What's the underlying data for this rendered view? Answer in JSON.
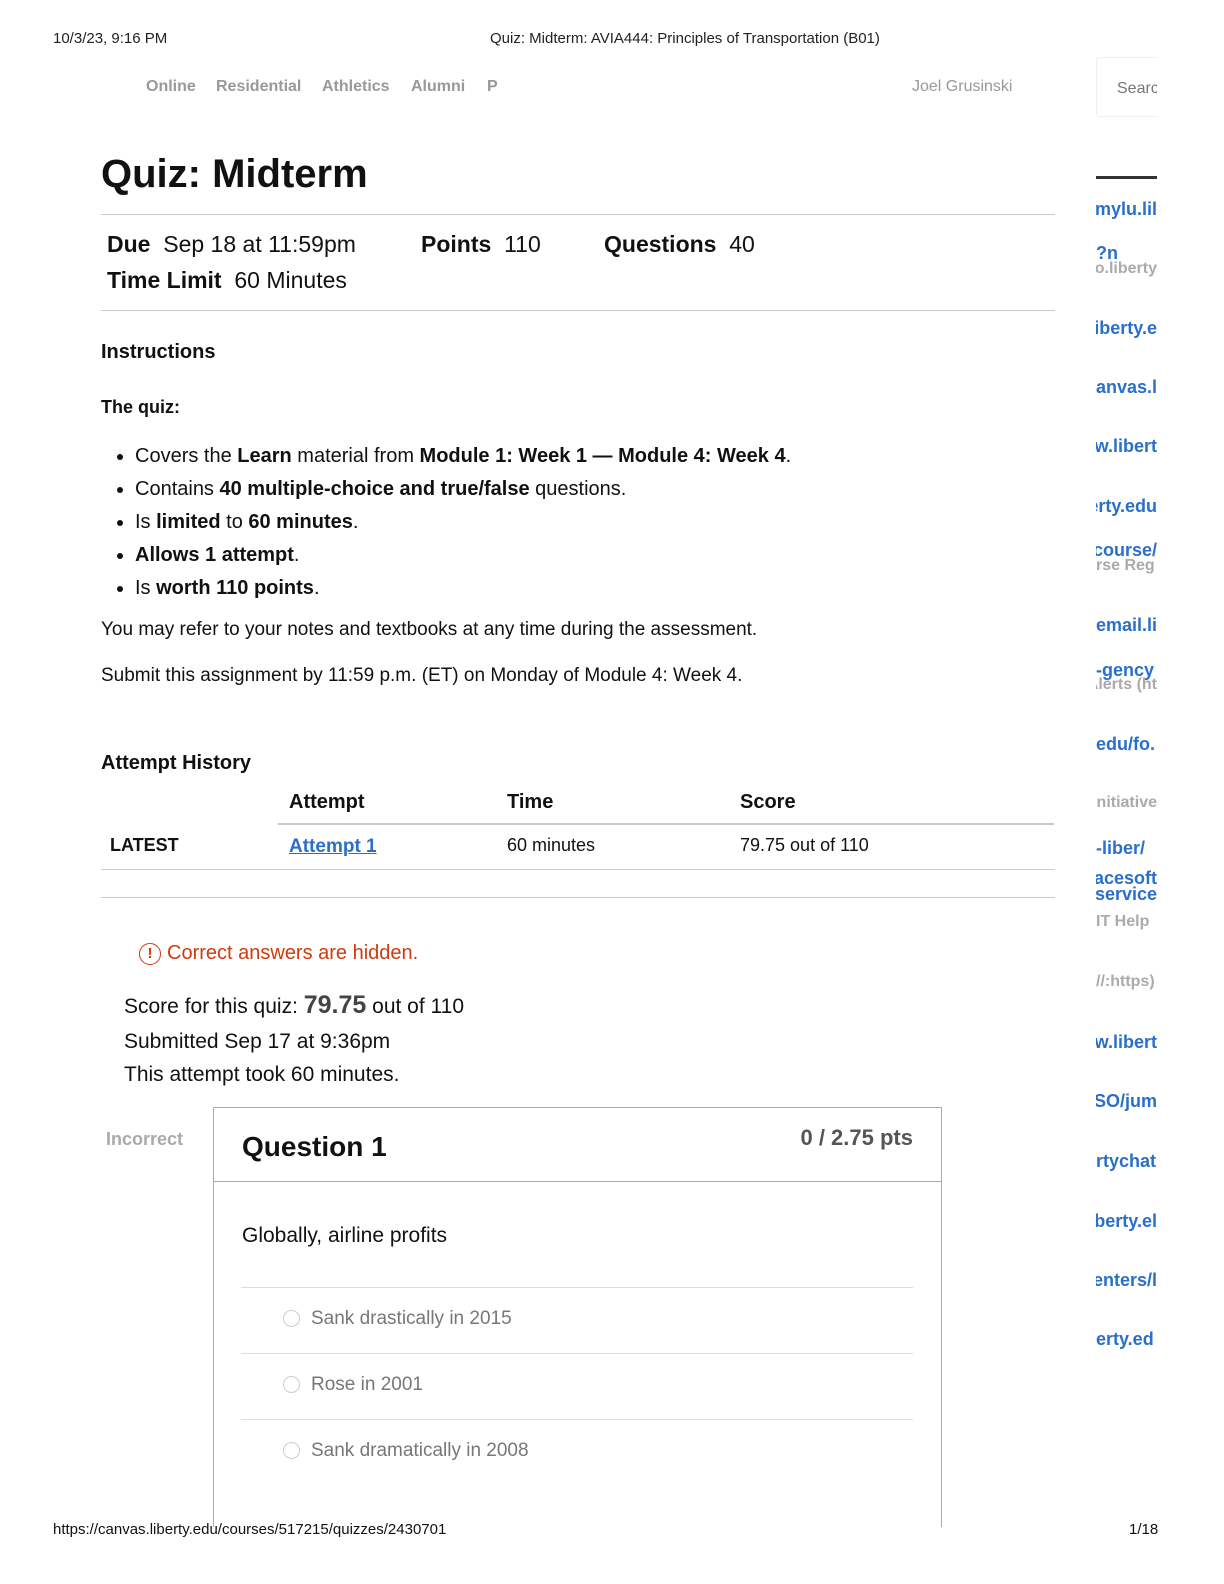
{
  "print_header": {
    "datetime": "10/3/23, 9:16 PM",
    "title": "Quiz: Midterm: AVIA444: Principles of Transportation (B01)"
  },
  "print_footer": {
    "url": "https://canvas.liberty.edu/courses/517215/quizzes/2430701",
    "page": "1/18"
  },
  "top_nav": {
    "items": [
      "Online",
      "Residential",
      "Athletics",
      "Alumni",
      "P"
    ],
    "user": "Joel Grusinski",
    "search_placeholder": "Searc"
  },
  "quiz": {
    "title": "Quiz: Midterm",
    "due_label": "Due",
    "due": "Sep 18 at 11:59pm",
    "points_label": "Points",
    "points": "110",
    "questions_label": "Questions",
    "questions": "40",
    "time_limit_label": "Time Limit",
    "time_limit": "60 Minutes"
  },
  "instructions": {
    "heading": "Instructions",
    "subheading": "The quiz:",
    "bullets": [
      [
        {
          "t": "Covers the "
        },
        {
          "t": "Learn",
          "b": true
        },
        {
          "t": " material from "
        },
        {
          "t": "Module 1: Week 1 — Module 4: Week 4",
          "b": true
        },
        {
          "t": "."
        }
      ],
      [
        {
          "t": "Contains "
        },
        {
          "t": "40 multiple-choice and true/false",
          "b": true
        },
        {
          "t": " questions."
        }
      ],
      [
        {
          "t": "Is "
        },
        {
          "t": "limited",
          "b": true
        },
        {
          "t": " to "
        },
        {
          "t": "60 minutes",
          "b": true
        },
        {
          "t": "."
        }
      ],
      [
        {
          "t": "Allows 1 attempt",
          "b": true
        },
        {
          "t": "."
        }
      ],
      [
        {
          "t": "Is "
        },
        {
          "t": "worth 110 points",
          "b": true
        },
        {
          "t": "."
        }
      ]
    ],
    "para1": "You may refer to your notes and textbooks at any time during the assessment.",
    "para2": "Submit this assignment by 11:59 p.m. (ET) on Monday of Module 4: Week 4."
  },
  "attempt_history": {
    "heading": "Attempt History",
    "columns": [
      "Attempt",
      "Time",
      "Score"
    ],
    "rows": [
      {
        "label": "LATEST",
        "attempt": "Attempt 1",
        "time": "60 minutes",
        "score": "79.75 out of 110"
      }
    ]
  },
  "results": {
    "notice": "Correct answers are hidden.",
    "score_prefix": "Score for this quiz: ",
    "score": "79.75",
    "score_suffix": " out of 110",
    "submitted": "Submitted Sep 17 at 9:36pm",
    "duration": "This attempt took 60 minutes."
  },
  "question": {
    "status": "Incorrect",
    "title": "Question 1",
    "points": "0 / 2.75 pts",
    "text": "Globally, airline profits",
    "answers": [
      "Sank drastically in 2015",
      "Rose in 2001",
      "Sank dramatically in 2008"
    ]
  },
  "sidebar_fragments": [
    {
      "t": "mylu.lil"
    },
    {
      "t": "n?"
    },
    {
      "t": "so.liberty",
      "g": true
    },
    {
      "t": "iberty.e"
    },
    {
      "t": "anvas.l"
    },
    {
      "t": "w.libert"
    },
    {
      "t": "erty.edu"
    },
    {
      "t": "/course"
    },
    {
      "t": "rse Reg",
      "g": true
    },
    {
      "t": "email.li"
    },
    {
      "t": "gency-"
    },
    {
      "t": "Alerts (ht",
      "g": true
    },
    {
      "t": ".edu/fo"
    },
    {
      "t": "Initiative",
      "g": true
    },
    {
      "t": "/liber-"
    },
    {
      "t": "acesoft"
    },
    {
      "t": "service-"
    },
    {
      "t": "IT Help",
      "g": true
    },
    {
      "t": "(https://",
      "g": true
    },
    {
      "t": "w.libert"
    },
    {
      "t": "SO/jum"
    },
    {
      "t": "rtychat"
    },
    {
      "t": "berty.el"
    },
    {
      "t": "enters/l"
    },
    {
      "t": "erty.ed"
    }
  ],
  "colors": {
    "link": "#2a6fca",
    "warning": "#d03a0e",
    "nav": "#999999"
  }
}
